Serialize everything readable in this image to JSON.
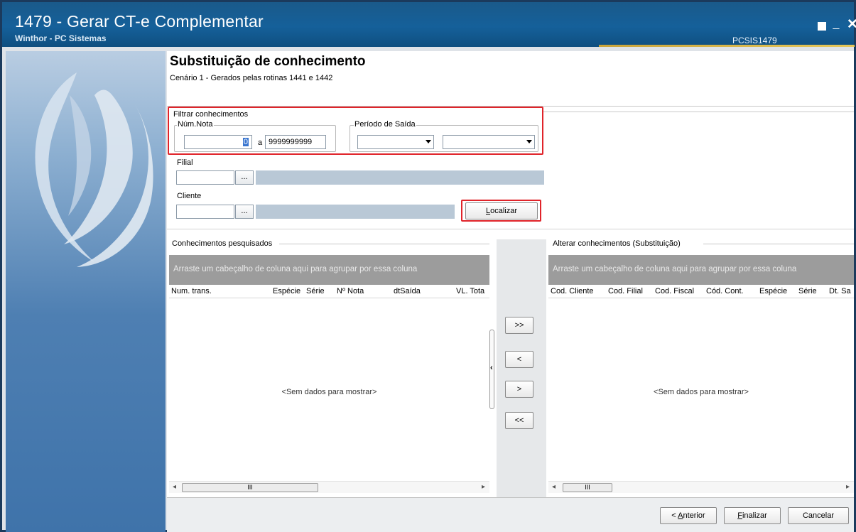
{
  "window": {
    "title": "1479 - Gerar CT-e Complementar",
    "subtitle": "Winthor - PC Sistemas",
    "code": "PCSIS1479",
    "controls": {
      "minimize": "_",
      "close": "✕"
    }
  },
  "colors": {
    "titlebar": "#15609a",
    "highlight": "#e0242a",
    "grid_header": "#9c9c9c"
  },
  "page": {
    "title": "Substituição de conhecimento",
    "description": "Cenário 1 - Gerados pelas rotinas 1441 e 1442"
  },
  "filter": {
    "group_label": "Filtrar conhecimentos",
    "num_nota": {
      "label": "Núm.Nota",
      "from": "0",
      "separator": "a",
      "to": "9999999999"
    },
    "periodo": {
      "label": "Período de Saída",
      "start": "",
      "end": ""
    },
    "filial": {
      "label": "Filial",
      "code": "",
      "name": "",
      "button": "..."
    },
    "cliente": {
      "label": "Cliente",
      "code": "",
      "name": "",
      "button": "..."
    },
    "search_button": {
      "mnemonic": "L",
      "rest": "ocalizar"
    }
  },
  "left_grid": {
    "title": "Conhecimentos pesquisados",
    "group_hint": "Arraste um cabeçalho de coluna aqui para agrupar por essa coluna",
    "columns": [
      "Num. trans.",
      "Espécie",
      "Série",
      "Nº Nota",
      "dtSaída",
      "VL. Tota"
    ],
    "empty": "<Sem dados para mostrar>",
    "scroll_thumb": "III"
  },
  "right_grid": {
    "title": "Alterar conhecimentos (Substituição)",
    "group_hint": "Arraste um cabeçalho de coluna aqui para agrupar por essa coluna",
    "columns": [
      "Cod. Cliente",
      "Cod. Filial",
      "Cod. Fiscal",
      "Cód. Cont.",
      "Espécie",
      "Série",
      "Dt. Sa"
    ],
    "empty": "<Sem dados para mostrar>",
    "scroll_thumb": "III"
  },
  "move_buttons": {
    "add_all": ">>",
    "remove_one": "<",
    "add_one": ">",
    "remove_all": "<<"
  },
  "footer": {
    "back": {
      "prefix": "< ",
      "mnemonic": "A",
      "rest": "nterior"
    },
    "finish": {
      "mnemonic": "F",
      "rest": "inalizar"
    },
    "cancel": "Cancelar"
  }
}
